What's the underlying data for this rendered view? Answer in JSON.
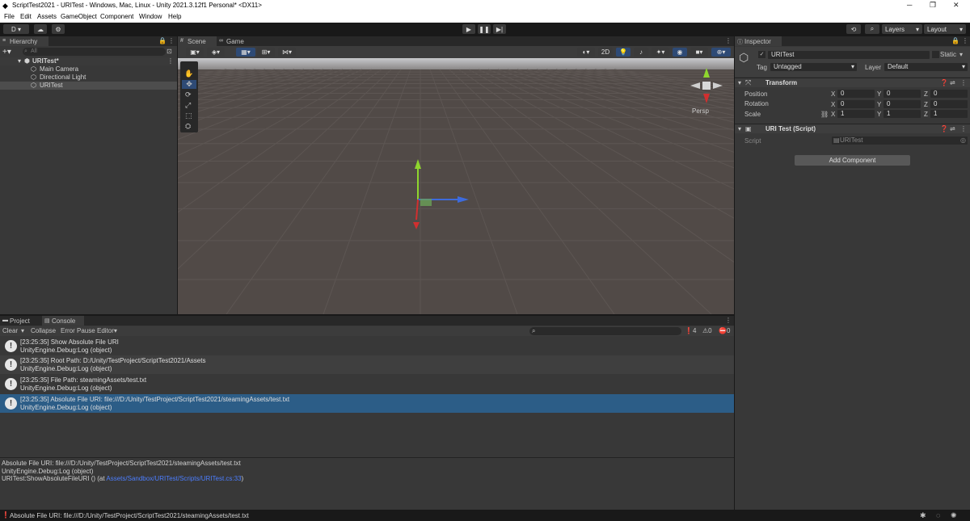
{
  "window": {
    "title": "ScriptTest2021 - URITest - Windows, Mac, Linux - Unity 2021.3.12f1 Personal* <DX11>",
    "minimize": "─",
    "maximize": "❐",
    "close": "✕"
  },
  "menu": [
    "File",
    "Edit",
    "Assets",
    "GameObject",
    "Component",
    "Window",
    "Help"
  ],
  "toolbar": {
    "account": "D",
    "layers": "Layers",
    "layout": "Layout"
  },
  "hierarchy": {
    "tab": "Hierarchy",
    "search_placeholder": "All",
    "scene": "URITest*",
    "items": [
      "Main Camera",
      "Directional Light",
      "URITest"
    ]
  },
  "scene_tabs": {
    "scene": "Scene",
    "game": "Game",
    "mode_2d": "2D",
    "persp": "Persp"
  },
  "inspector": {
    "tab": "Inspector",
    "object_name": "URITest",
    "static_label": "Static",
    "tag_label": "Tag",
    "tag_value": "Untagged",
    "layer_label": "Layer",
    "layer_value": "Default",
    "transform": {
      "title": "Transform",
      "position_label": "Position",
      "rotation_label": "Rotation",
      "scale_label": "Scale",
      "position": [
        "0",
        "0",
        "0"
      ],
      "rotation": [
        "0",
        "0",
        "0"
      ],
      "scale": [
        "1",
        "1",
        "1"
      ],
      "axes": [
        "X",
        "Y",
        "Z"
      ]
    },
    "script_component": {
      "title": "URI Test (Script)",
      "script_label": "Script",
      "script_value": "URITest"
    },
    "add_component": "Add Component"
  },
  "bottom_tabs": {
    "project": "Project",
    "console": "Console"
  },
  "console": {
    "clear": "Clear",
    "collapse": "Collapse",
    "error_pause": "Error Pause",
    "editor": "Editor",
    "log_count": "4",
    "warn_count": "0",
    "error_count": "0",
    "entries": [
      {
        "line1": "[23:25:35] Show Absolute File URI",
        "line2": "UnityEngine.Debug:Log (object)"
      },
      {
        "line1": "[23:25:35] Root Path: D:/Unity/TestProject/ScriptTest2021/Assets",
        "line2": "UnityEngine.Debug:Log (object)"
      },
      {
        "line1": "[23:25:35] File Path: steamingAssets/test.txt",
        "line2": "UnityEngine.Debug:Log (object)"
      },
      {
        "line1": "[23:25:35] Absolute File URI: file:///D:/Unity/TestProject/ScriptTest2021/steamingAssets/test.txt",
        "line2": "UnityEngine.Debug:Log (object)"
      }
    ],
    "detail": {
      "line1": "Absolute File URI: file:///D:/Unity/TestProject/ScriptTest2021/steamingAssets/test.txt",
      "line2": "UnityEngine.Debug:Log (object)",
      "line3_prefix": "URITest:ShowAbsoluteFileURI () (at ",
      "line3_link": "Assets/Sandbox/URITest/Scripts/URITest.cs:33",
      "line3_suffix": ")"
    }
  },
  "statusbar": {
    "message": "Absolute File URI: file:///D:/Unity/TestProject/ScriptTest2021/steamingAssets/test.txt"
  },
  "colors": {
    "selection": "#2c5d87",
    "panel": "#383838",
    "link": "#4c7eff"
  }
}
